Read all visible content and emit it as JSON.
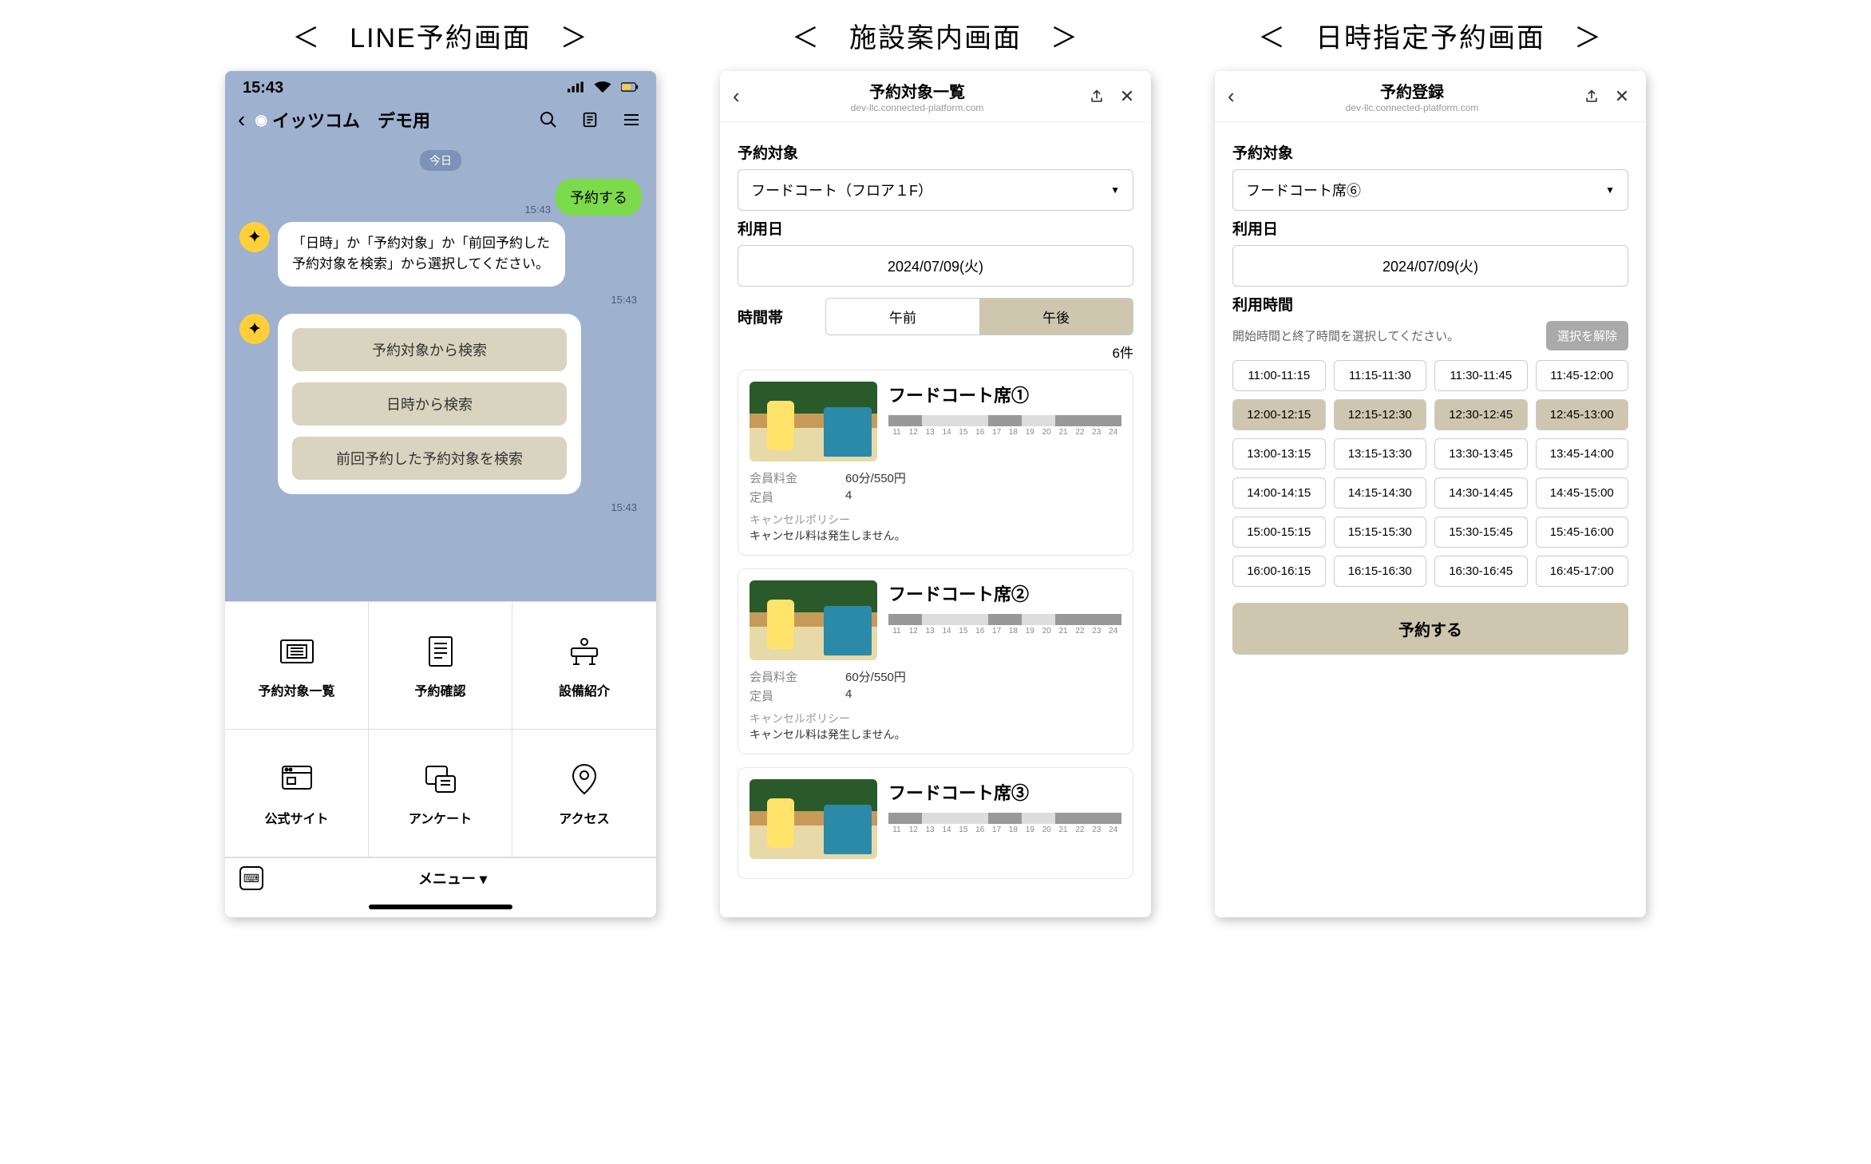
{
  "panel_titles": {
    "p1": "＜　LINE予約画面　＞",
    "p2": "＜　施設案内画面　＞",
    "p3": "＜　日時指定予約画面　＞"
  },
  "line": {
    "clock": "15:43",
    "account": "イッツコム　デモ用",
    "date_pill": "今日",
    "user_msg": "予約する",
    "ts1": "15:43",
    "bot_msg": "「日時」か「予約対象」か「前回予約した予約対象を検索」から選択してください。",
    "ts2": "15:43",
    "options": [
      "予約対象から検索",
      "日時から検索",
      "前回予約した予約対象を検索"
    ],
    "ts3": "15:43",
    "menu": [
      "予約対象一覧",
      "予約確認",
      "設備紹介",
      "公式サイト",
      "アンケート",
      "アクセス"
    ],
    "menu_label": "メニュー ▾"
  },
  "list": {
    "title": "予約対象一覧",
    "host": "dev-llc.connected-platform.com",
    "target_label": "予約対象",
    "target_value": "フードコート（フロア１F）",
    "date_label": "利用日",
    "date_value": "2024/07/09(火)",
    "time_label": "時間帯",
    "seg_am": "午前",
    "seg_pm": "午後",
    "count": "6件",
    "hours": [
      "11",
      "12",
      "13",
      "14",
      "15",
      "16",
      "17",
      "18",
      "19",
      "20",
      "21",
      "22",
      "23",
      "24"
    ],
    "fee_label": "会員料金",
    "fee_value": "60分/550円",
    "cap_label": "定員",
    "cap_value": "4",
    "policy_label": "キャンセルポリシー",
    "policy_text": "キャンセル料は発生しません。",
    "cards": [
      {
        "name": "フードコート席①"
      },
      {
        "name": "フードコート席②"
      },
      {
        "name": "フードコート席③"
      }
    ]
  },
  "book": {
    "title": "予約登録",
    "host": "dev-llc.connected-platform.com",
    "target_label": "予約対象",
    "target_value": "フードコート席⑥",
    "date_label": "利用日",
    "date_value": "2024/07/09(火)",
    "time_label": "利用時間",
    "hint": "開始時間と終了時間を選択してください。",
    "clear": "選択を解除",
    "slots": [
      {
        "t": "11:00-11:15",
        "s": false
      },
      {
        "t": "11:15-11:30",
        "s": false
      },
      {
        "t": "11:30-11:45",
        "s": false
      },
      {
        "t": "11:45-12:00",
        "s": false
      },
      {
        "t": "12:00-12:15",
        "s": true
      },
      {
        "t": "12:15-12:30",
        "s": true
      },
      {
        "t": "12:30-12:45",
        "s": true
      },
      {
        "t": "12:45-13:00",
        "s": true
      },
      {
        "t": "13:00-13:15",
        "s": false
      },
      {
        "t": "13:15-13:30",
        "s": false
      },
      {
        "t": "13:30-13:45",
        "s": false
      },
      {
        "t": "13:45-14:00",
        "s": false
      },
      {
        "t": "14:00-14:15",
        "s": false
      },
      {
        "t": "14:15-14:30",
        "s": false
      },
      {
        "t": "14:30-14:45",
        "s": false
      },
      {
        "t": "14:45-15:00",
        "s": false
      },
      {
        "t": "15:00-15:15",
        "s": false
      },
      {
        "t": "15:15-15:30",
        "s": false
      },
      {
        "t": "15:30-15:45",
        "s": false
      },
      {
        "t": "15:45-16:00",
        "s": false
      },
      {
        "t": "16:00-16:15",
        "s": false
      },
      {
        "t": "16:15-16:30",
        "s": false
      },
      {
        "t": "16:30-16:45",
        "s": false
      },
      {
        "t": "16:45-17:00",
        "s": false
      }
    ],
    "submit": "予約する"
  }
}
